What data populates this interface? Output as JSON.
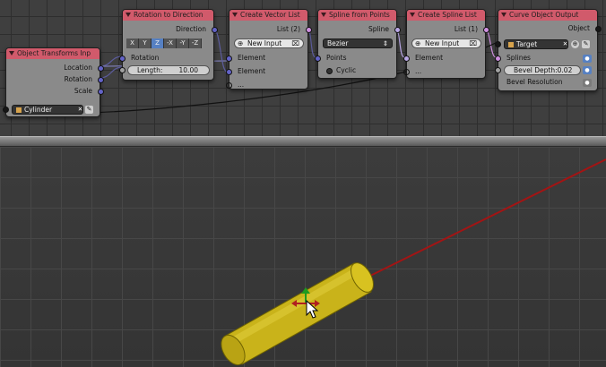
{
  "nodes": {
    "object_transforms": {
      "title": "Object Transforms Inp",
      "outputs": [
        "Location",
        "Rotation",
        "Scale"
      ],
      "object_value": "Cylinder"
    },
    "rotation_to_direction": {
      "title": "Rotation to Direction",
      "output": "Direction",
      "axes": [
        "X",
        "Y",
        "Z",
        "-X",
        "-Y",
        "-Z"
      ],
      "active_axis": "Z",
      "input_rotation": "Rotation",
      "length_label": "Length:",
      "length_value": "10.00"
    },
    "create_vector_list": {
      "title": "Create Vector List",
      "output": "List (2)",
      "new_input_label": "New Input",
      "elements": [
        "Element",
        "Element"
      ],
      "more": "..."
    },
    "spline_from_points": {
      "title": "Spline from Points",
      "output": "Spline",
      "type_value": "Bezier",
      "inputs": [
        "Points",
        "Cyclic"
      ]
    },
    "create_spline_list": {
      "title": "Create Spline List",
      "output": "List (1)",
      "new_input_label": "New Input",
      "elements": [
        "Element"
      ],
      "more": "..."
    },
    "curve_object_output": {
      "title": "Curve Object Output",
      "output": "Object",
      "target_value": "Target",
      "inputs": [
        "Splines",
        "Bevel Depth:0.02",
        "Bevel Resolution"
      ]
    }
  },
  "icons": {
    "close": "✕",
    "eyedropper": "eyedropper-icon",
    "plus": "⊕"
  },
  "colors": {
    "node_header": "#d15a6b",
    "vector_socket": "#6363c7",
    "object_socket": "#161616",
    "list_socket": "#cf8fe0",
    "cylinder": "#c9b31a",
    "direction_line": "#a31414"
  }
}
